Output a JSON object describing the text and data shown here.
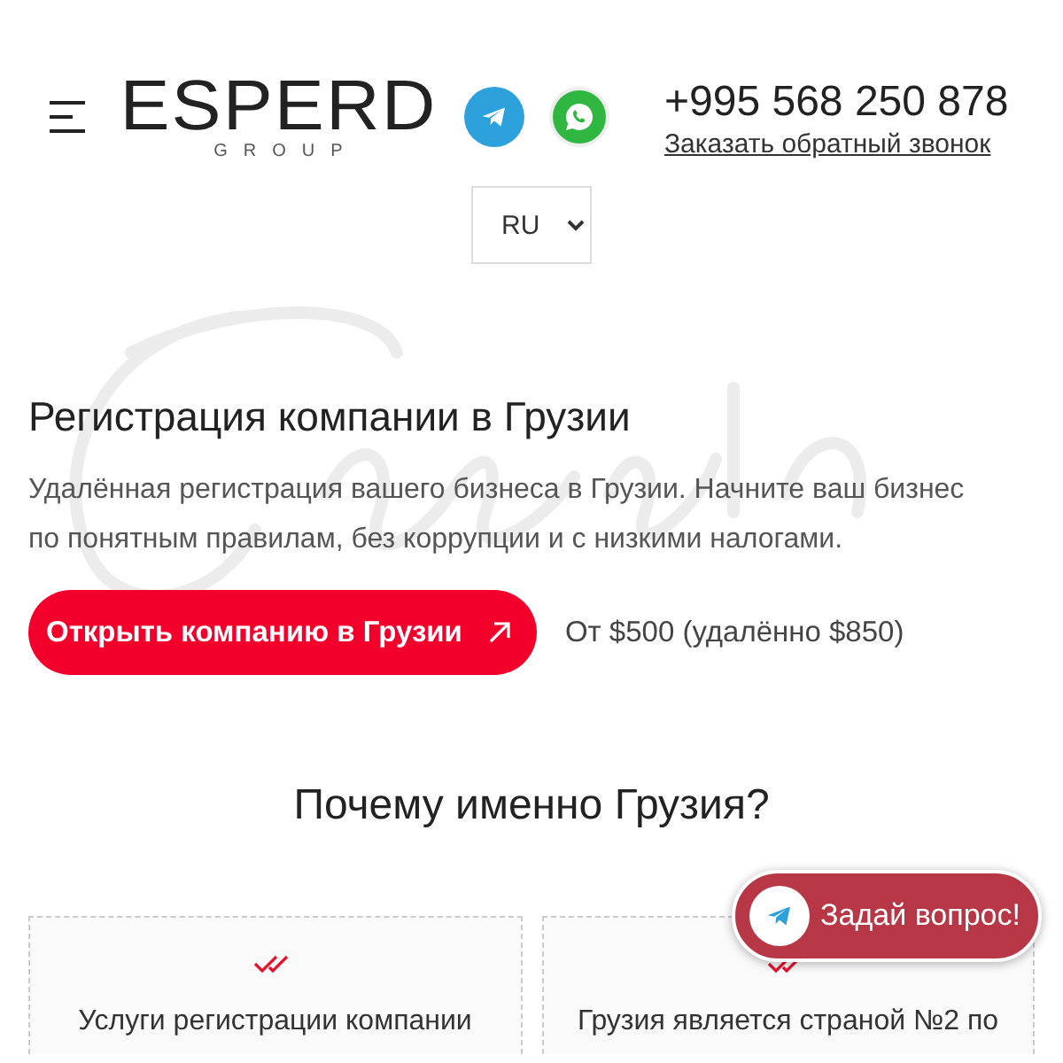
{
  "header": {
    "logo": {
      "name": "ESPERD",
      "sub": "GROUP"
    },
    "phone": "+995 568 250 878",
    "callback_link": "Заказать обратный звонок",
    "language": "RU"
  },
  "hero": {
    "title": "Регистрация компании в Грузии",
    "text": "Удалённая регистрация вашего бизнеса в Грузии. Начните ваш бизнес по понятным правилам, без коррупции и с низкими налогами.",
    "cta": "Открыть компанию в Грузии",
    "price": "От $500 (удалённо $850)"
  },
  "why": {
    "title": "Почему именно Грузия?",
    "cards": [
      {
        "text": "Услуги регистрации компании"
      },
      {
        "text": "Грузия является страной №2 по"
      }
    ]
  },
  "chat_button": {
    "label": "Задай вопрос!"
  }
}
